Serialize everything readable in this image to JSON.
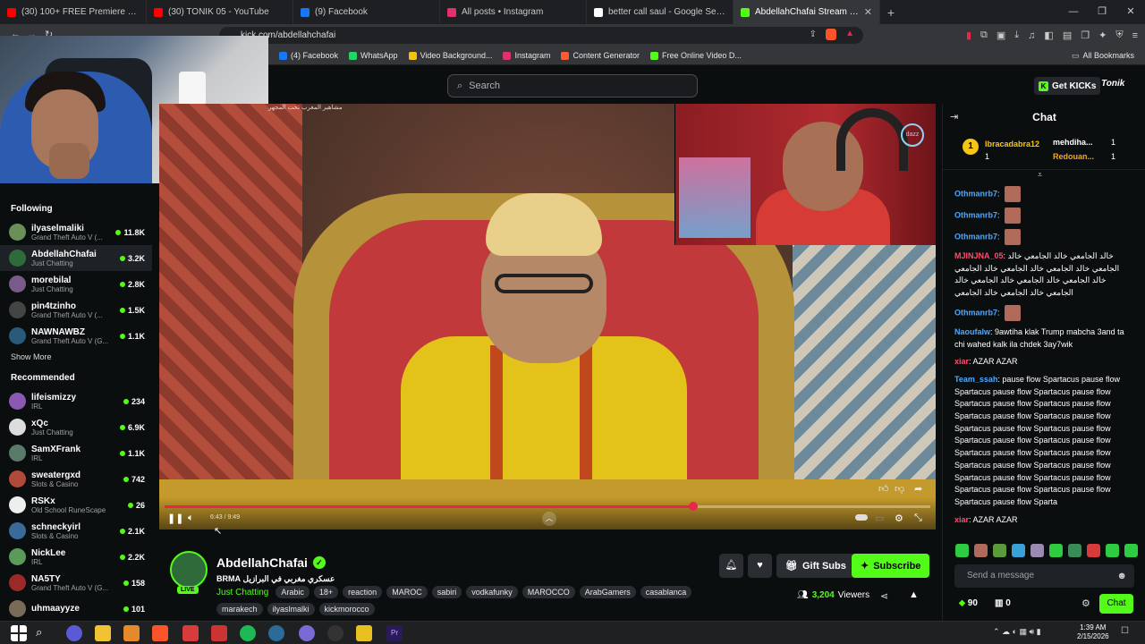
{
  "browser": {
    "tabs": [
      {
        "label": "(30) 100+ FREE Premiere Pro Transitio",
        "color": "#ff0000"
      },
      {
        "label": "(30) TONIK 05 - YouTube",
        "color": "#ff0000"
      },
      {
        "label": "(9) Facebook",
        "color": "#1877f2"
      },
      {
        "label": "All posts • Instagram",
        "color": "#e1306c"
      },
      {
        "label": "better call saul - Google Search",
        "color": "#ffffff"
      },
      {
        "label": "AbdellahChafai Stream - Watc",
        "color": "#53fc18",
        "active": true
      }
    ],
    "url": "kick.com/abdellahchafai",
    "bookmarks": [
      {
        "label": "(4) Facebook",
        "color": "#1877f2"
      },
      {
        "label": "WhatsApp",
        "color": "#25d366"
      },
      {
        "label": "Video Background...",
        "color": "#f4c20d"
      },
      {
        "label": "Instagram",
        "color": "#e1306c"
      },
      {
        "label": "Content Generator",
        "color": "#ff5a36"
      },
      {
        "label": "Free Online Video D...",
        "color": "#53fc18"
      }
    ],
    "all_bookmarks": "All Bookmarks"
  },
  "header": {
    "search_placeholder": "Search",
    "get_kicks": "Get KICKs",
    "tonik": "Tonik"
  },
  "sidebar": {
    "following_title": "Following",
    "following": [
      {
        "name": "ilyaselmaliki",
        "category": "Grand Theft Auto V (...",
        "count": "11.8K",
        "color": "#6a8f5a"
      },
      {
        "name": "AbdellahChafai",
        "category": "Just Chatting",
        "count": "3.2K",
        "color": "#2f6b3a",
        "selected": true
      },
      {
        "name": "morebilal",
        "category": "Just Chatting",
        "count": "2.8K",
        "color": "#7a5a8a"
      },
      {
        "name": "pin4tzinho",
        "category": "Grand Theft Auto V (...",
        "count": "1.5K",
        "color": "#444"
      },
      {
        "name": "NAWNAWBZ",
        "category": "Grand Theft Auto V (G...",
        "count": "1.1K",
        "color": "#2a5a7a"
      }
    ],
    "show_more": "Show More",
    "recommended_title": "Recommended",
    "recommended": [
      {
        "name": "lifeismizzy",
        "category": "IRL",
        "count": "234",
        "color": "#8a5ab0"
      },
      {
        "name": "xQc",
        "category": "Just Chatting",
        "count": "6.9K",
        "color": "#ddd"
      },
      {
        "name": "SamXFrank",
        "category": "IRL",
        "count": "1.1K",
        "color": "#5a7a6a"
      },
      {
        "name": "sweatergxd",
        "category": "Slots & Casino",
        "count": "742",
        "color": "#b04a3a"
      },
      {
        "name": "RSKx",
        "category": "Old School RuneScape",
        "count": "26",
        "color": "#eee"
      },
      {
        "name": "schneckyirl",
        "category": "Slots & Casino",
        "count": "2.1K",
        "color": "#3a6a9a"
      },
      {
        "name": "NickLee",
        "category": "IRL",
        "count": "2.2K",
        "color": "#5a9a5a"
      },
      {
        "name": "NA5TY",
        "category": "Grand Theft Auto V (G...",
        "count": "158",
        "color": "#9a2a2a"
      },
      {
        "name": "uhmaayyze",
        "category": "",
        "count": "101",
        "color": "#7a6a5a"
      }
    ]
  },
  "player": {
    "time": "6:43 / 9:49",
    "progress": 0.69,
    "caption_top": "مشاهير المغرب تحت المجهر"
  },
  "stream": {
    "name": "AbdellahChafai",
    "live": "LIVE",
    "title": "عسكري مغربي في البرازيل BRMA",
    "category": "Just Chatting",
    "tags_row1": [
      "Arabic",
      "18+",
      "reaction",
      "MAROC",
      "sabiri",
      "vodkafunky",
      "MAROCCO",
      "ArabGamers"
    ],
    "tags_row2": [
      "casablanca",
      "marakech",
      "ilyaslmalki",
      "kickmorocco"
    ],
    "gift_subs": "Gift Subs",
    "subscribe": "Subscribe",
    "viewers_count": "3,204",
    "viewers_label": "Viewers"
  },
  "chat": {
    "title": "Chat",
    "pinned": [
      {
        "name": "Ibracadabra12",
        "count": "1",
        "color": "#f5c518"
      },
      {
        "name": "mehdiha...",
        "count": "1",
        "color": "#ffffff"
      },
      {
        "name": "Redouan...",
        "count": "1",
        "color": "#f5a623"
      }
    ],
    "rank": "1",
    "messages": [
      {
        "user": "Othmanrb7",
        "text": "",
        "color": "#4ea8ff",
        "emote": true
      },
      {
        "user": "Othmanrb7",
        "text": "",
        "color": "#4ea8ff",
        "emote": true
      },
      {
        "user": "Othmanrb7",
        "text": "",
        "color": "#4ea8ff",
        "emote": true
      },
      {
        "user": "MJINJNA_05",
        "text": "خالد الجامعي خالد الجامعي خالد الجامعي خالد الجامعي خالد الجامعي خالد الجامعي خالد الجامعي خالد الجامعي خالد الجامعي خالد الجامعي خالد الجامعي خالد الجامعي",
        "color": "#ff4d6d",
        "emote": false
      },
      {
        "user": "Othmanrb7",
        "text": "",
        "color": "#4ea8ff",
        "emote": true
      },
      {
        "user": "Naoufalw",
        "text": "9awtiha klak Trump mabcha 3and ta chi wahed kalk ila chdek 3ay7wik",
        "color": "#4ea8ff",
        "emote": false
      },
      {
        "user": "xiar",
        "text": "AZAR AZAR",
        "color": "#ff4d6d",
        "emote": false
      },
      {
        "user": "Team_ssah",
        "text": "pause flow Spartacus pause flow Spartacus pause flow Spartacus pause flow Spartacus pause flow Spartacus pause flow Spartacus pause flow Spartacus pause flow Spartacus pause flow Spartacus pause flow Spartacus pause flow Spartacus pause flow Spartacus pause flow Spartacus pause flow Spartacus pause flow Spartacus pause flow Spartacus pause flow Spartacus pause flow Spartacus pause flow Spartacus pause flow Spartacus pause flow Sparta",
        "color": "#4ea8ff",
        "emote": false
      },
      {
        "user": "xiar",
        "text": "AZAR AZAR",
        "color": "#ff4d6d",
        "emote": false
      }
    ],
    "input_placeholder": "Send a message",
    "kicks_balance": "90",
    "bag_balance": "0",
    "chat_button": "Chat"
  },
  "taskbar": {
    "time": "1:39 AM",
    "date": "2/15/2026"
  }
}
